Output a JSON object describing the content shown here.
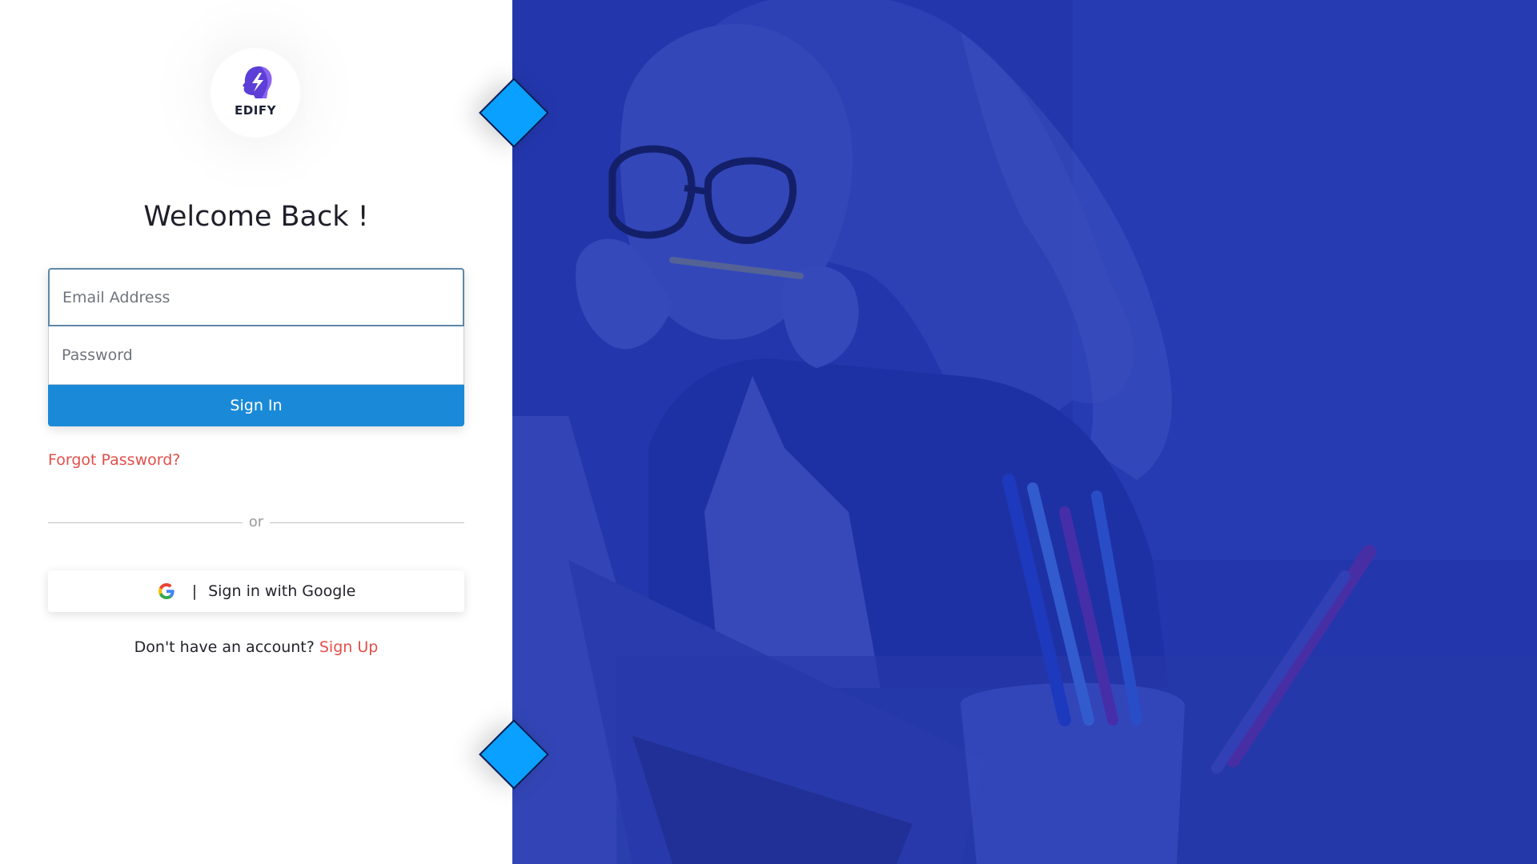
{
  "brand": {
    "name": "EDIFY",
    "logo_icon": "head-lightning-logo-icon"
  },
  "login": {
    "heading": "Welcome Back !",
    "email_placeholder": "Email Address",
    "password_placeholder": "Password",
    "signin_label": "Sign In",
    "forgot_label": "Forgot Password?",
    "divider_text": "or",
    "google_separator": "|",
    "google_label": "Sign in with Google",
    "signup_prompt": "Don't have an account?",
    "signup_label": "Sign Up"
  },
  "colors": {
    "primary_button": "#1a8ad8",
    "link_red": "#e24f4a",
    "hero_overlay": "#2236ad",
    "diamond_accent": "#0aa0ff"
  },
  "hero": {
    "image": "woman-with-laptop-and-pencils-photo"
  }
}
